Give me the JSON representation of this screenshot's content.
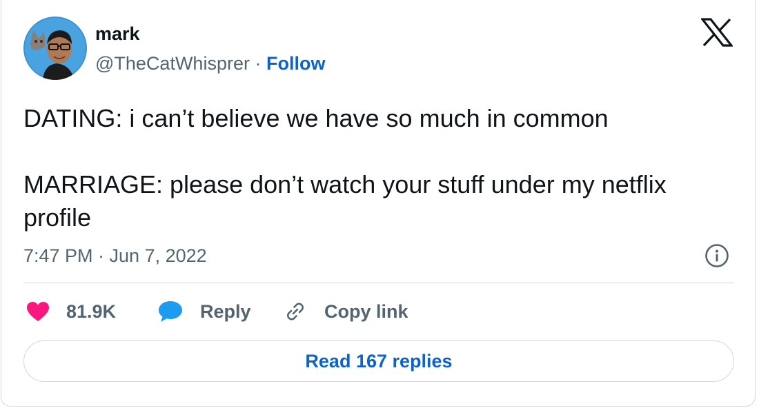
{
  "author": {
    "name": "mark",
    "handle": "@TheCatWhisprer",
    "separator": "·",
    "follow_label": "Follow"
  },
  "tweet": {
    "paragraphs": [
      "DATING: i can’t believe we have so much in common",
      "MARRIAGE: please don’t watch your stuff under my netflix profile"
    ],
    "timestamp": "7:47 PM · Jun 7, 2022"
  },
  "actions": {
    "like_count": "81.9K",
    "reply_label": "Reply",
    "copy_link_label": "Copy link"
  },
  "read_replies_label": "Read 167 replies",
  "icons": {
    "brand": "x-logo-icon",
    "info": "info-icon",
    "like": "heart-icon",
    "reply": "speech-bubble-icon",
    "copy": "link-icon"
  },
  "colors": {
    "text": "#0f1419",
    "secondary": "#536471",
    "link": "#0c63c9",
    "like": "#f91880",
    "reply": "#1d9bf0",
    "border": "#cfd9de"
  }
}
